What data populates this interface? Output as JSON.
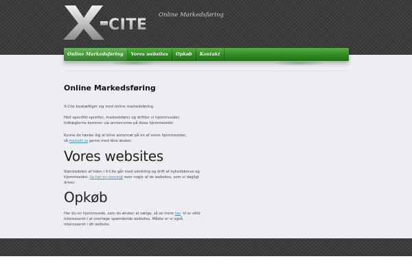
{
  "header": {
    "logo_text": "X-CITE",
    "tagline": "Online Markedsføring"
  },
  "nav": {
    "items": [
      {
        "label": "Online Markedsføring",
        "active": true
      },
      {
        "label": "Vores websites",
        "active": false
      },
      {
        "label": "Opkøb",
        "active": false
      },
      {
        "label": "Kontakt",
        "active": false
      }
    ]
  },
  "main": {
    "title": "Online Markedsføring",
    "intro": "X-Cite beskæftiger sig med online markedsføring.",
    "para2_line1": "Helt specifikt opretter, markedsfører og driftter vi hjemmesider.",
    "para2_line2": "Indtægterne kommer via annoncerne på disse hjemmesider.",
    "para3_line1": "Kunne du tænke dig at blive annoncør på en af vores hjemmesider,",
    "para3_pre": "så ",
    "para3_link": "kontakt os",
    "para3_post": " gerne med dine ønsker.",
    "websites_heading": "Vores websites",
    "websites_pre": "Størstedelen af tiden i X-Cite går med udvikling og drift af nyhedsbreve og hjemmesider. ",
    "websites_link": "Se her en oversigt",
    "websites_post": " over nogle af de websites, som vi dagligt driver.",
    "opkob_heading": "Opkøb",
    "opkob_pre": "Har du en hjemmeside, som du ønsker at sælge, så se mere ",
    "opkob_link": "her",
    "opkob_post": ". Vi er altid interesseret i at overtage spændende websites. Måske er vi også interesseret i dit website."
  },
  "colors": {
    "nav_green": "#2f8a22",
    "header_dark": "#3b3b3b",
    "link": "#3a8fc0"
  }
}
